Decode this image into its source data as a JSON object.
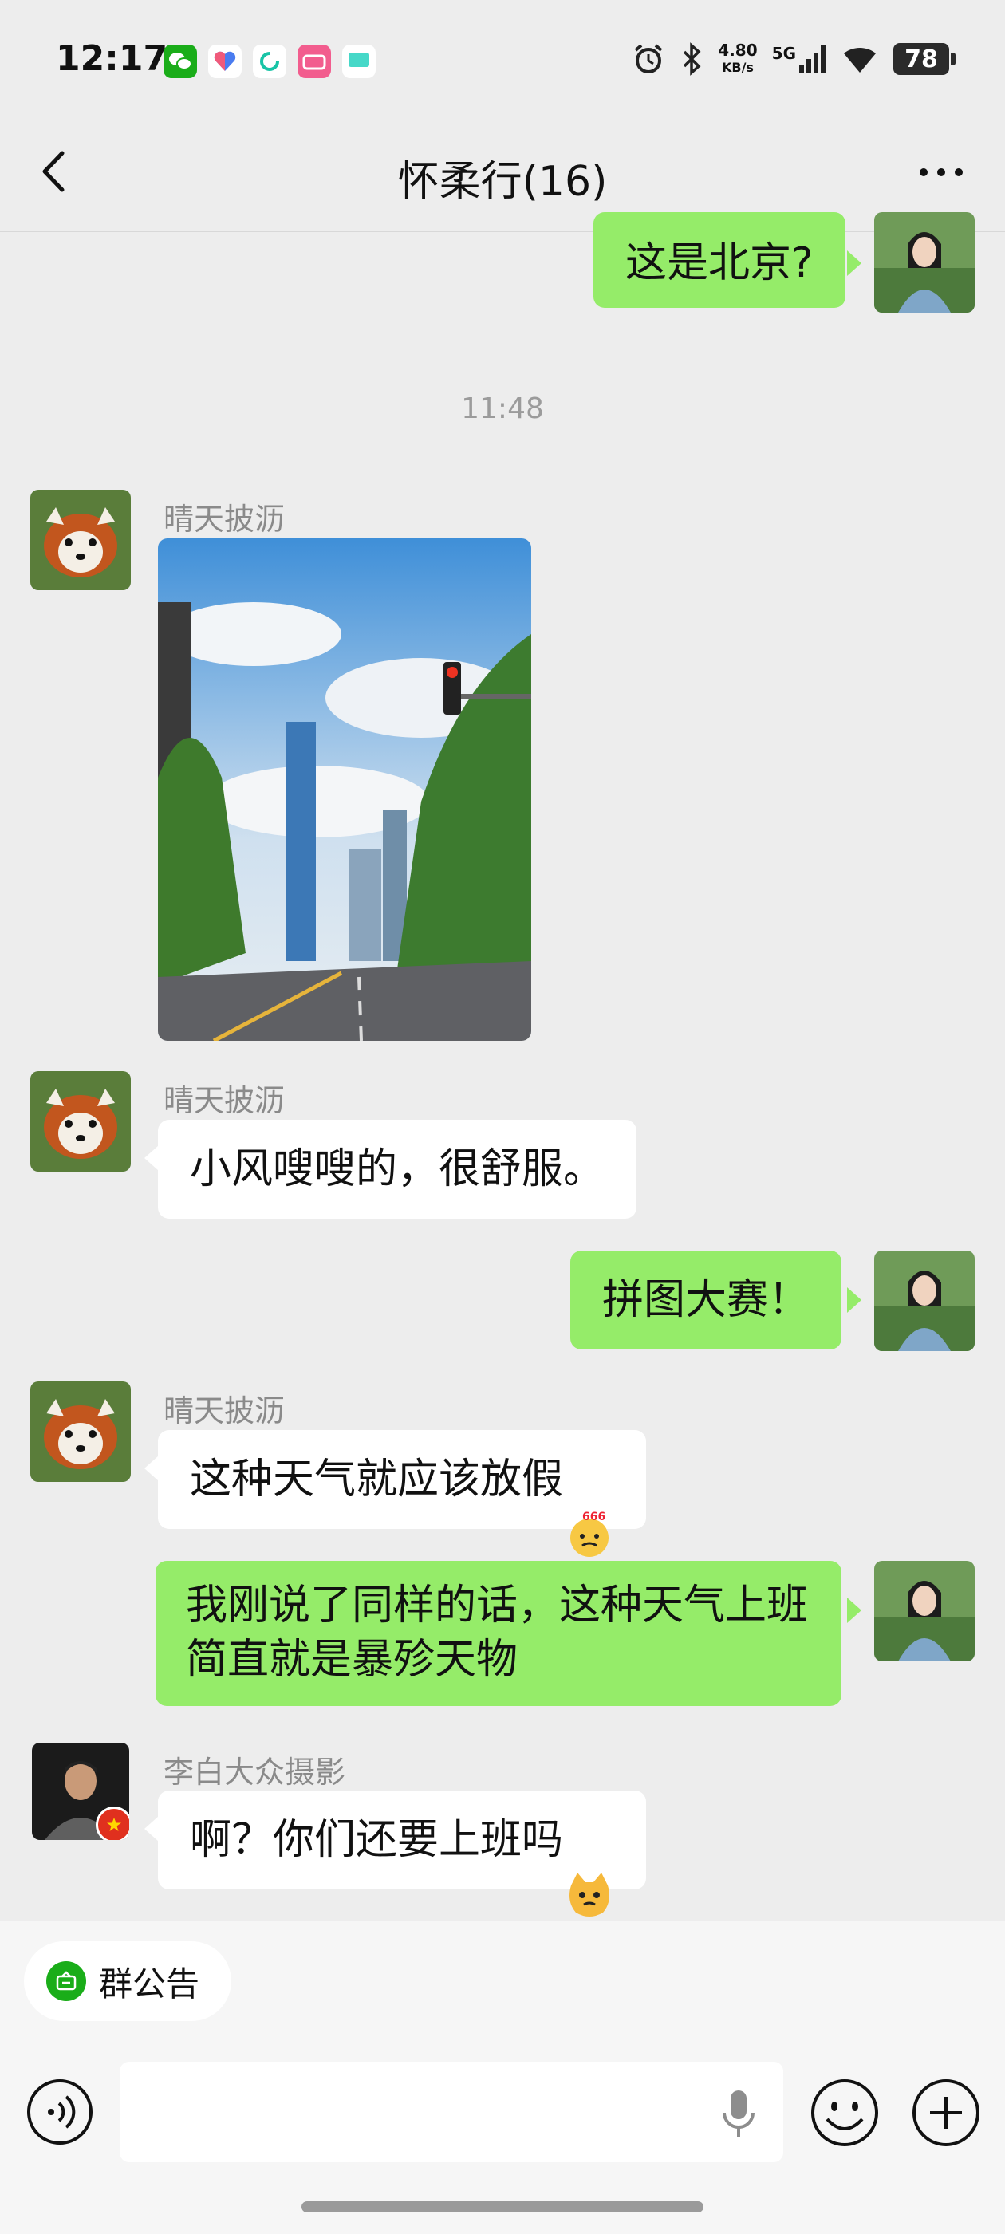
{
  "status_bar": {
    "time": "12:17",
    "net_speed_value": "4.80",
    "net_speed_unit": "KB/s",
    "network": "5G",
    "battery": "78",
    "app_icons": [
      "wechat-icon",
      "heart-app-icon",
      "refresh-app-icon",
      "bilibili-icon",
      "message-app-icon"
    ]
  },
  "nav": {
    "title": "怀柔行(16)"
  },
  "chat": {
    "timestamp": "11:48",
    "messages": [
      {
        "side": "right",
        "text": "这是北京?"
      },
      {
        "side": "left",
        "sender": "晴天披沥",
        "type": "image"
      },
      {
        "side": "left",
        "sender": "晴天披沥",
        "text": "小风嗖嗖的，很舒服。"
      },
      {
        "side": "right",
        "text": "拼图大赛！"
      },
      {
        "side": "left",
        "sender": "晴天披沥",
        "text": "这种天气就应该放假",
        "emoji": "666-emoji"
      },
      {
        "side": "right",
        "text": "我刚说了同样的话，这种天气上班\n简直就是暴殄天物"
      },
      {
        "side": "left",
        "sender": "李白大众摄影",
        "text": "啊？你们还要上班吗",
        "emoji": "cat-emoji"
      }
    ]
  },
  "bottom": {
    "notice_label": "群公告"
  },
  "colors": {
    "background": "#ededed",
    "bubble_self": "#95ec69",
    "bubble_other": "#ffffff",
    "notice_green": "#1aad19"
  }
}
